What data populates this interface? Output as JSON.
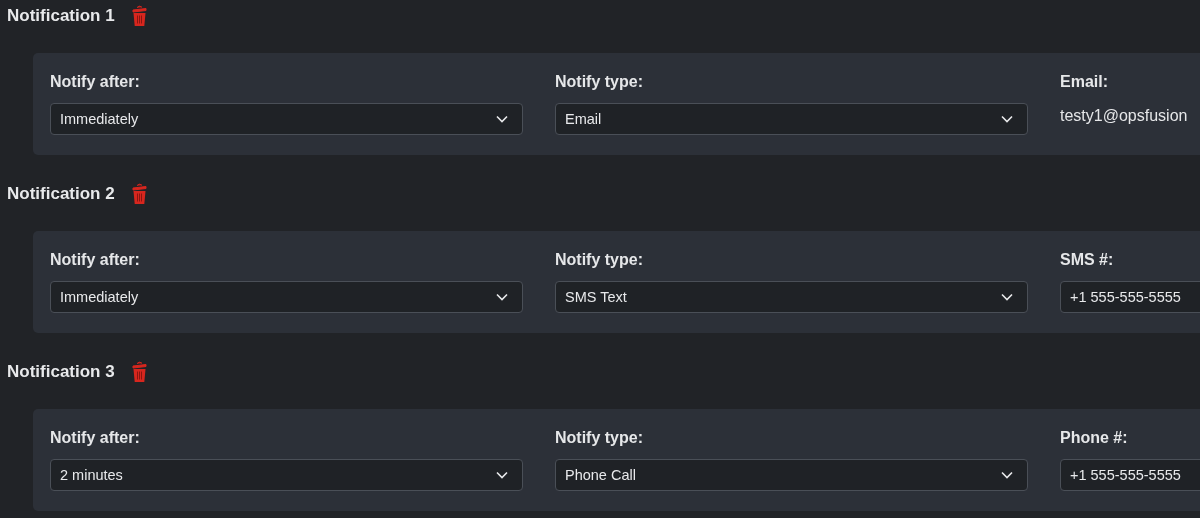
{
  "notifications": [
    {
      "title": "Notification 1",
      "fields": [
        {
          "kind": "select",
          "label": "Notify after:",
          "value": "Immediately"
        },
        {
          "kind": "select",
          "label": "Notify type:",
          "value": "Email"
        },
        {
          "kind": "text",
          "label": "Email:",
          "value": "testy1@opsfusion"
        }
      ]
    },
    {
      "title": "Notification 2",
      "fields": [
        {
          "kind": "select",
          "label": "Notify after:",
          "value": "Immediately"
        },
        {
          "kind": "select",
          "label": "Notify type:",
          "value": "SMS Text"
        },
        {
          "kind": "input",
          "label": "SMS #:",
          "value": "+1 555-555-5555"
        }
      ]
    },
    {
      "title": "Notification 3",
      "fields": [
        {
          "kind": "select",
          "label": "Notify after:",
          "value": "2 minutes"
        },
        {
          "kind": "select",
          "label": "Notify type:",
          "value": "Phone Call"
        },
        {
          "kind": "input",
          "label": "Phone #:",
          "value": "+1 555-555-5555"
        }
      ]
    }
  ]
}
